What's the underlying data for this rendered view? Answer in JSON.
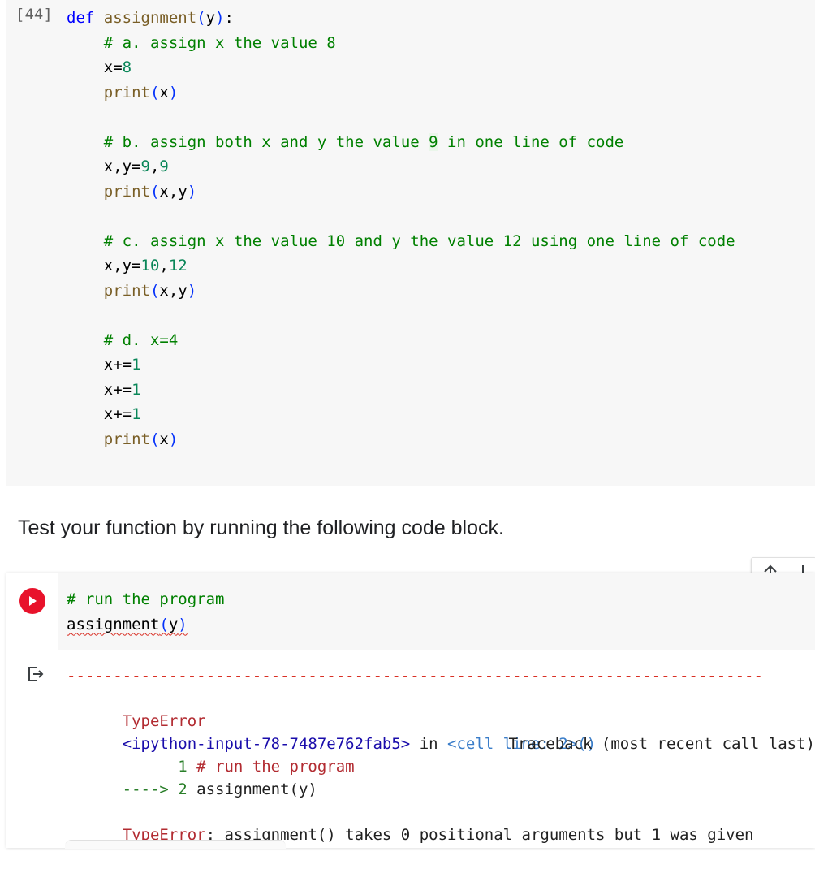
{
  "cell1": {
    "exec_count": "[44]",
    "lines": [
      {
        "parts": [
          [
            "kw",
            "def "
          ],
          [
            "fn",
            "assignment"
          ],
          [
            "pn",
            "("
          ],
          [
            "tx",
            "y"
          ],
          [
            "pn",
            ")"
          ],
          [
            "tx",
            ":"
          ]
        ]
      },
      {
        "parts": [
          [
            "tx",
            "    "
          ],
          [
            "cm",
            "# a. assign x the value 8"
          ]
        ]
      },
      {
        "parts": [
          [
            "tx",
            "    x="
          ],
          [
            "nm",
            "8"
          ]
        ]
      },
      {
        "parts": [
          [
            "tx",
            "    "
          ],
          [
            "fn",
            "print"
          ],
          [
            "pn",
            "("
          ],
          [
            "tx",
            "x"
          ],
          [
            "pn",
            ")"
          ]
        ]
      },
      {
        "parts": [
          [
            "tx",
            ""
          ]
        ]
      },
      {
        "parts": [
          [
            "tx",
            "    "
          ],
          [
            "cm",
            "# b. assign both x and y the value "
          ],
          [
            "cmhl",
            "9"
          ],
          [
            "cm",
            " in one line of code"
          ]
        ]
      },
      {
        "parts": [
          [
            "tx",
            "    x,y="
          ],
          [
            "nm",
            "9"
          ],
          [
            "tx",
            ","
          ],
          [
            "nm",
            "9"
          ]
        ]
      },
      {
        "parts": [
          [
            "tx",
            "    "
          ],
          [
            "fn",
            "print"
          ],
          [
            "pn",
            "("
          ],
          [
            "tx",
            "x,y"
          ],
          [
            "pn",
            ")"
          ]
        ]
      },
      {
        "parts": [
          [
            "tx",
            ""
          ]
        ]
      },
      {
        "parts": [
          [
            "tx",
            "    "
          ],
          [
            "cm",
            "# c. assign x the value 10 and y the value 12 using one line of code"
          ]
        ]
      },
      {
        "parts": [
          [
            "tx",
            "    x,y="
          ],
          [
            "nm",
            "10"
          ],
          [
            "tx",
            ","
          ],
          [
            "nm",
            "12"
          ]
        ]
      },
      {
        "parts": [
          [
            "tx",
            "    "
          ],
          [
            "fn",
            "print"
          ],
          [
            "pn",
            "("
          ],
          [
            "tx",
            "x,y"
          ],
          [
            "pn",
            ")"
          ]
        ]
      },
      {
        "parts": [
          [
            "tx",
            ""
          ]
        ]
      },
      {
        "parts": [
          [
            "tx",
            "    "
          ],
          [
            "cm",
            "# d. x=4"
          ]
        ]
      },
      {
        "parts": [
          [
            "tx",
            "    x+="
          ],
          [
            "nm",
            "1"
          ]
        ]
      },
      {
        "parts": [
          [
            "tx",
            "    x+="
          ],
          [
            "nm",
            "1"
          ]
        ]
      },
      {
        "parts": [
          [
            "tx",
            "    x+="
          ],
          [
            "nm",
            "1"
          ]
        ]
      },
      {
        "parts": [
          [
            "tx",
            "    "
          ],
          [
            "fn",
            "print"
          ],
          [
            "pn",
            "("
          ],
          [
            "tx",
            "x"
          ],
          [
            "pn",
            ")"
          ]
        ]
      }
    ]
  },
  "markdown": {
    "text": "Test your function by running the following code block."
  },
  "toolbar": {
    "move_up_icon": "arrow-up",
    "move_down_icon": "arrow-down"
  },
  "cell2": {
    "run_icon": "play",
    "comment": "# run the program",
    "call_fn": "assignment",
    "call_paren_open": "(",
    "call_arg": "y",
    "call_paren_close": ")",
    "output_icon": "output-redirect"
  },
  "output": {
    "dashes": "---------------------------------------------------------------------------",
    "error_name": "TypeError",
    "traceback_label": "Traceback (most recent call last)",
    "link_text": "<ipython-input-78-7487e762fab5>",
    "in_word": " in ",
    "cell_ref": "<cell line: 2>()",
    "line1_num": "      1 ",
    "line1_code": "# run the program",
    "arrow": "----> 2 ",
    "line2_code": "assignment(y)",
    "final_error_name": "TypeError",
    "final_error_msg": ": assignment() takes 0 positional arguments but 1 was given"
  },
  "colors": {
    "run_button": "#e8122b",
    "error_red": "#b22b31",
    "link": "#1a0dab"
  }
}
